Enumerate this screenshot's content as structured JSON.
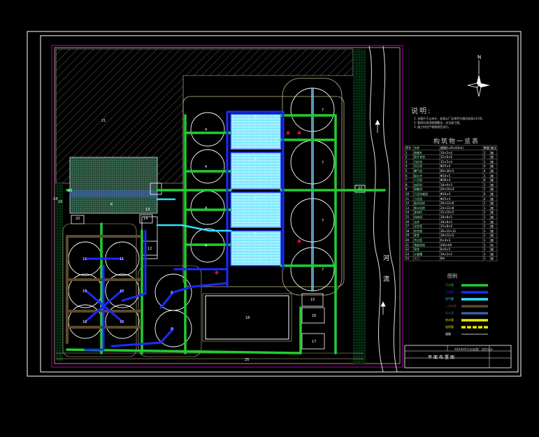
{
  "drawing": {
    "notes_title": "说明:",
    "notes": [
      "1. 本图尺寸以米计，标高以厂区地坪为相对标高±0.00。",
      "2. 管线均采用地埋敷设，详见施工图。",
      "3. 施工时应严格按规范进行。"
    ],
    "table_title": "构筑物一览表",
    "table_header": [
      "序号",
      "名称",
      "规格(L×B×H)(m)",
      "数量",
      "备注"
    ],
    "table_rows": [
      [
        "1",
        "格栅井",
        "10×5×4",
        "1",
        "座"
      ],
      [
        "2",
        "提升泵房",
        "12×6×6",
        "1",
        "座"
      ],
      [
        "3",
        "沉砂池",
        "15×5×4",
        "1",
        "座"
      ],
      [
        "4",
        "初沉池",
        "Φ25×4",
        "4",
        "座"
      ],
      [
        "5",
        "曝气池",
        "60×30×5",
        "4",
        "座"
      ],
      [
        "6",
        "配水井",
        "Φ10×5",
        "1",
        "座"
      ],
      [
        "7",
        "二沉池",
        "Φ30×4",
        "6",
        "座"
      ],
      [
        "8",
        "加药间",
        "18×9×5",
        "1",
        "座"
      ],
      [
        "9",
        "接触池",
        "20×10×4",
        "1",
        "座"
      ],
      [
        "10",
        "污泥浓缩池",
        "Φ16×4",
        "4",
        "座"
      ],
      [
        "11",
        "污泥池",
        "Φ15×4",
        "2",
        "座"
      ],
      [
        "12",
        "鼓风机房",
        "30×12×6",
        "1",
        "座"
      ],
      [
        "13",
        "脱水机房",
        "24×12×8",
        "1",
        "座"
      ],
      [
        "14",
        "变电所",
        "15×10×5",
        "1",
        "座"
      ],
      [
        "15",
        "机修间",
        "18×8×5",
        "1",
        "座"
      ],
      [
        "16",
        "仓库",
        "18×8×5",
        "1",
        "座"
      ],
      [
        "17",
        "化验室",
        "15×8×4",
        "1",
        "座"
      ],
      [
        "18",
        "综合楼",
        "36×15×12",
        "1",
        "座"
      ],
      [
        "19",
        "食堂",
        "18×12×5",
        "1",
        "座"
      ],
      [
        "20",
        "传达室",
        "6×4×3",
        "1",
        "座"
      ],
      [
        "21",
        "预留用地",
        "200×60",
        "1",
        "处"
      ],
      [
        "22",
        "泵房",
        "8×6×5",
        "1",
        "座"
      ],
      [
        "23",
        "计量槽",
        "10×2×2",
        "1",
        "座"
      ],
      [
        "24",
        "大门",
        "8m",
        "1",
        "座"
      ]
    ],
    "legend_title": "图例",
    "legend": [
      {
        "label": "污水管",
        "color": "#22cc33"
      },
      {
        "label": "污泥管",
        "color": "#1a2cff"
      },
      {
        "label": "空气管",
        "color": "#33e0ff"
      },
      {
        "label": "上清液管",
        "color": "#5c4a2a"
      },
      {
        "label": "雨水管",
        "color": "#3a5fa0"
      },
      {
        "label": "给水管",
        "color": "#e8e800"
      },
      {
        "label": "加药管",
        "color": "#e8e800"
      },
      {
        "label": "道路",
        "color": "#ffffff"
      }
    ],
    "plan_title": "平面布置图",
    "designer_line": "XXX市XX污水处理厂 初步设计",
    "river_chars": [
      "河",
      "流"
    ],
    "north_label": "N",
    "unit_labels": {
      "reserve": "21",
      "tank_a": "4",
      "tank_b": "5",
      "clar": "7",
      "thick": "10",
      "sludge": "11",
      "bldg": "18",
      "u12": "12",
      "u13": "13",
      "u14": "14",
      "u15": "15",
      "u16": "16",
      "u17": "17",
      "u19": "19",
      "u20": "20",
      "u22": "22",
      "u23": "23",
      "u24": "24",
      "u25": "25",
      "u6": "6",
      "u8": "8"
    }
  }
}
